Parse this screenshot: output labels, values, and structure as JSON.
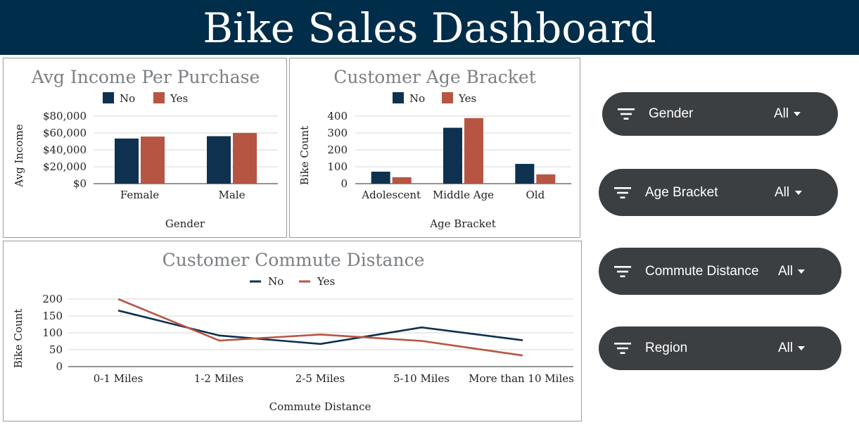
{
  "header": {
    "title": "Bike Sales Dashboard"
  },
  "colors": {
    "header_bg": "#002d49",
    "no": "#0e3150",
    "yes": "#b65642",
    "filter_bg": "#3c3f42",
    "title_gray": "#7b7f83"
  },
  "filters": [
    {
      "label": "Gender",
      "value": "All",
      "icon": "filter-icon"
    },
    {
      "label": "Age Bracket",
      "value": "All",
      "icon": "filter-icon"
    },
    {
      "label": "Commute Distance",
      "value": "All",
      "icon": "filter-icon"
    },
    {
      "label": "Region",
      "value": "All",
      "icon": "filter-icon"
    }
  ],
  "chart_data": [
    {
      "type": "bar",
      "title": "Avg Income Per Purchase",
      "xlabel": "Gender",
      "ylabel": "Avg Income",
      "categories": [
        "Female",
        "Male"
      ],
      "series": [
        {
          "name": "No",
          "values": [
            53440,
            56208
          ]
        },
        {
          "name": "Yes",
          "values": [
            55774,
            60124
          ]
        }
      ],
      "ylim": [
        0,
        80000
      ],
      "yticks": [
        0,
        20000,
        40000,
        60000,
        80000
      ],
      "ytick_labels": [
        "$0",
        "$20,000",
        "$40,000",
        "$60,000",
        "$80,000"
      ],
      "legend": "top",
      "grid": true
    },
    {
      "type": "bar",
      "title": "Customer Age Bracket",
      "xlabel": "Age Bracket",
      "ylabel": "Bike Count",
      "categories": [
        "Adolescent",
        "Middle Age",
        "Old"
      ],
      "series": [
        {
          "name": "No",
          "values": [
            71,
            331,
            117
          ]
        },
        {
          "name": "Yes",
          "values": [
            38,
            388,
            55
          ]
        }
      ],
      "ylim": [
        0,
        400
      ],
      "yticks": [
        0,
        100,
        200,
        300,
        400
      ],
      "ytick_labels": [
        "0",
        "100",
        "200",
        "300",
        "400"
      ],
      "legend": "top",
      "grid": true
    },
    {
      "type": "line",
      "title": "Customer Commute Distance",
      "xlabel": "Commute Distance",
      "ylabel": "Bike Count",
      "categories": [
        "0-1 Miles",
        "1-2 Miles",
        "2-5 Miles",
        "5-10 Miles",
        "More than 10 Miles"
      ],
      "series": [
        {
          "name": "No",
          "values": [
            166,
            92,
            67,
            116,
            78
          ]
        },
        {
          "name": "Yes",
          "values": [
            200,
            77,
            95,
            76,
            33
          ]
        }
      ],
      "ylim": [
        0,
        200
      ],
      "yticks": [
        0,
        50,
        100,
        150,
        200
      ],
      "ytick_labels": [
        "0",
        "50",
        "100",
        "150",
        "200"
      ],
      "legend": "top",
      "grid": true
    }
  ]
}
